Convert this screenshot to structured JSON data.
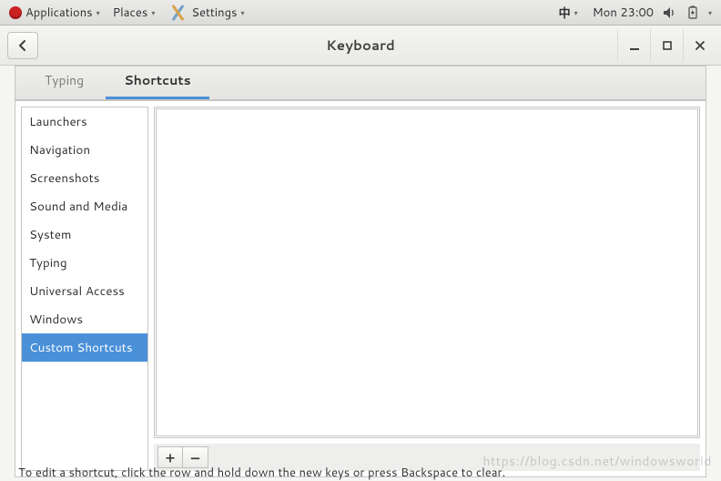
{
  "panel": {
    "apps": "Applications",
    "places": "Places",
    "settings": "Settings",
    "ime": "中",
    "clock": "Mon 23:00"
  },
  "window": {
    "title": "Keyboard"
  },
  "tabs": {
    "typing": "Typing",
    "shortcuts": "Shortcuts",
    "active": "shortcuts"
  },
  "categories": [
    "Launchers",
    "Navigation",
    "Screenshots",
    "Sound and Media",
    "System",
    "Typing",
    "Universal Access",
    "Windows",
    "Custom Shortcuts"
  ],
  "selected_category_index": 8,
  "buttons": {
    "add": "+",
    "remove": "−"
  },
  "hint": "To edit a shortcut, click the row and hold down the new keys or press Backspace to clear.",
  "watermark": "https://blog.csdn.net/windowsworld"
}
